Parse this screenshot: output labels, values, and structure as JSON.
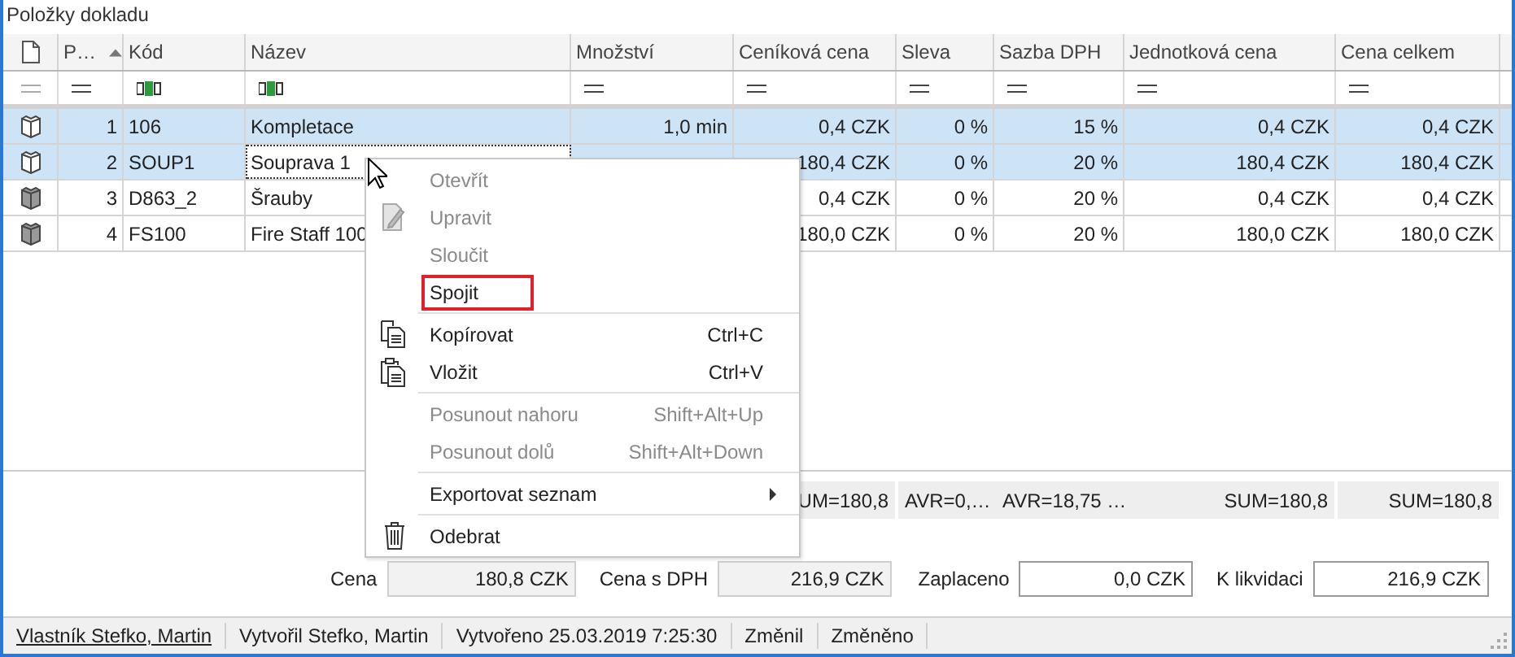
{
  "panel_title": "Položky dokladu",
  "columns": [
    {
      "kind": "icon",
      "sorted": false
    },
    {
      "label": "P…",
      "kind": "number",
      "sorted": true
    },
    {
      "label": "Kód",
      "kind": "text",
      "sorted": false
    },
    {
      "label": "Název",
      "kind": "text",
      "sorted": false
    },
    {
      "label": "Množství",
      "kind": "number",
      "sorted": false
    },
    {
      "label": "Ceníková cena",
      "kind": "number",
      "sorted": false
    },
    {
      "label": "Sleva",
      "kind": "number",
      "sorted": false
    },
    {
      "label": "Sazba DPH",
      "kind": "number",
      "sorted": false
    },
    {
      "label": "Jednotková cena",
      "kind": "number",
      "sorted": false
    },
    {
      "label": "Cena celkem",
      "kind": "number",
      "sorted": false
    }
  ],
  "rows": [
    {
      "selected": true,
      "focused": false,
      "cells": [
        null,
        "1",
        "106",
        "Kompletace",
        "1,0 min",
        "0,4 CZK",
        "0 %",
        "15 %",
        "0,4 CZK",
        "0,4 CZK"
      ]
    },
    {
      "selected": true,
      "focused": true,
      "cells": [
        null,
        "2",
        "SOUP1",
        "Souprava 1",
        null,
        "180,4 CZK",
        "0 %",
        "20 %",
        "180,4 CZK",
        "180,4 CZK"
      ]
    },
    {
      "selected": false,
      "focused": false,
      "cells": [
        null,
        "3",
        "D863_2",
        "Šrauby",
        null,
        "0,4 CZK",
        "0 %",
        "20 %",
        "0,4 CZK",
        "0,4 CZK"
      ]
    },
    {
      "selected": false,
      "focused": false,
      "cells": [
        null,
        "4",
        "FS100",
        "Fire Staff 100",
        null,
        "180,0 CZK",
        "0 %",
        "20 %",
        "180,0 CZK",
        "180,0 CZK"
      ]
    }
  ],
  "summary": [
    "UM=180,8",
    "AVR=0,…",
    "AVR=18,75 …",
    "SUM=180,8",
    "SUM=180,8"
  ],
  "totals": [
    {
      "label": "Cena",
      "value": "180,8 CZK",
      "readonly": true
    },
    {
      "label": "Cena s DPH",
      "value": "216,9 CZK",
      "readonly": true
    },
    {
      "label": "Zaplaceno",
      "value": "0,0 CZK",
      "readonly": false
    },
    {
      "label": "K likvidaci",
      "value": "216,9 CZK",
      "readonly": false
    }
  ],
  "status_bar": [
    {
      "text": "Vlastník Stefko, Martin",
      "link": true
    },
    {
      "text": "Vytvořil Stefko, Martin",
      "link": false
    },
    {
      "text": "Vytvořeno 25.03.2019 7:25:30",
      "link": false
    },
    {
      "text": "Změnil",
      "link": false
    },
    {
      "text": "Změněno",
      "link": false
    }
  ],
  "context_menu": [
    {
      "label": "Otevřít",
      "kind": "plain",
      "disabled": true,
      "separator_before": false,
      "highlighted": false
    },
    {
      "label": "Upravit",
      "disabled": true,
      "kind": "edit",
      "separator_before": false,
      "highlighted": false
    },
    {
      "label": "Sloučit",
      "kind": "plain",
      "disabled": true,
      "separator_before": false,
      "highlighted": false
    },
    {
      "label": "Spojit",
      "kind": "plain",
      "disabled": false,
      "separator_before": false,
      "highlighted": true
    },
    {
      "label": "Kopírovat",
      "shortcut": "Ctrl+C",
      "kind": "copy",
      "disabled": false,
      "separator_before": true,
      "highlighted": false
    },
    {
      "label": "Vložit",
      "shortcut": "Ctrl+V",
      "kind": "paste",
      "disabled": false,
      "separator_before": false,
      "highlighted": false
    },
    {
      "label": "Posunout nahoru",
      "shortcut": "Shift+Alt+Up",
      "kind": "plain",
      "disabled": true,
      "separator_before": true,
      "highlighted": false
    },
    {
      "label": "Posunout dolů",
      "shortcut": "Shift+Alt+Down",
      "kind": "plain",
      "disabled": true,
      "separator_before": false,
      "highlighted": false
    },
    {
      "label": "Exportovat seznam",
      "submenu": true,
      "kind": "plain",
      "disabled": false,
      "separator_before": true,
      "highlighted": false
    },
    {
      "label": "Odebrat",
      "kind": "delete",
      "disabled": false,
      "separator_before": true,
      "highlighted": false
    }
  ]
}
